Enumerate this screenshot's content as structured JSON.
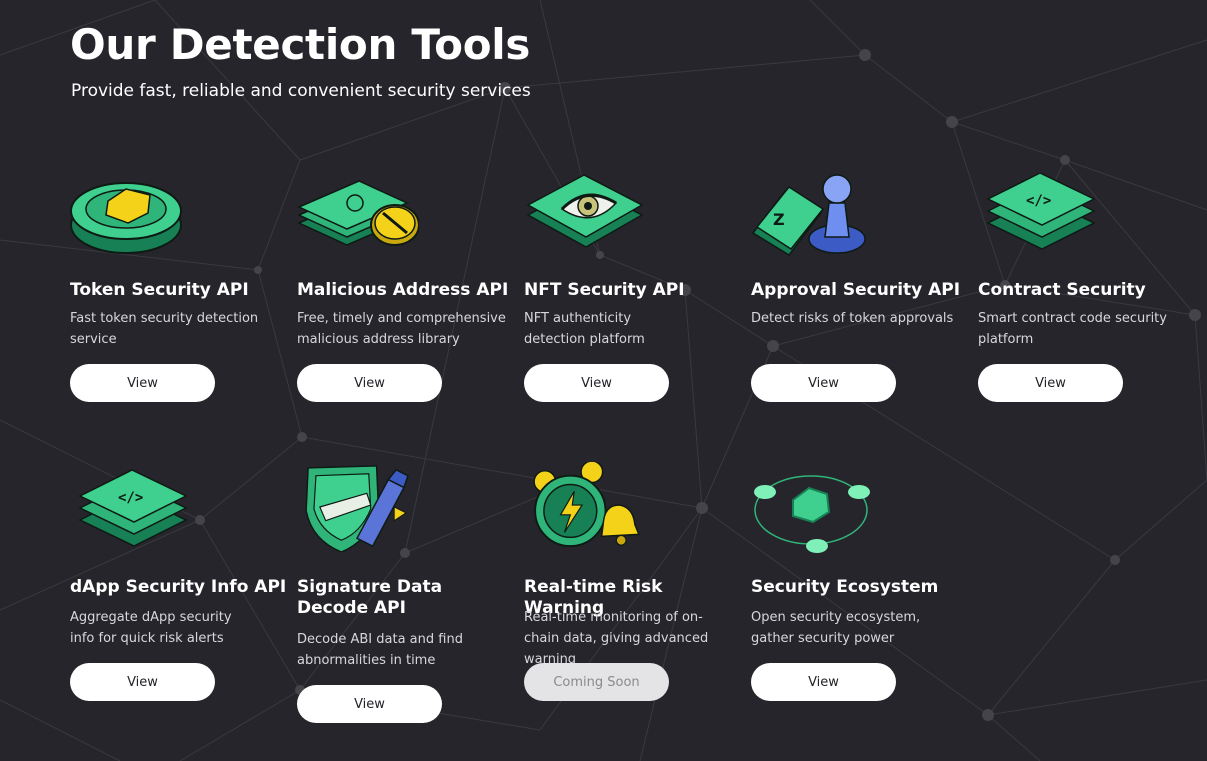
{
  "page": {
    "title": "Our Detection Tools",
    "subtitle": "Provide fast, reliable and convenient security services"
  },
  "cards": [
    {
      "title": "Token Security API",
      "description": "Fast token security detection service",
      "button": "View",
      "icon": "token-coin-icon"
    },
    {
      "title": "Malicious Address API",
      "description": "Free, timely and comprehensive malicious address library",
      "button": "View",
      "icon": "banknote-stack-icon"
    },
    {
      "title": "NFT Security API",
      "description": "NFT authenticity detection platform",
      "button": "View",
      "icon": "eye-tile-icon"
    },
    {
      "title": "Approval Security API",
      "description": "Detect risks of token approvals",
      "button": "View",
      "icon": "approval-stamp-icon"
    },
    {
      "title": "Contract Security",
      "description": "Smart contract code security platform",
      "button": "View",
      "icon": "code-layers-icon"
    },
    {
      "title": "dApp Security Info API",
      "description": "Aggregate dApp security info for quick risk alerts",
      "button": "View",
      "icon": "code-layers-icon"
    },
    {
      "title": "Signature Data Decode API",
      "description": "Decode ABI data and find abnormalities in time",
      "button": "View",
      "icon": "shield-pen-icon"
    },
    {
      "title": "Real-time Risk Warning",
      "description": "Real-time monitoring of on-chain data, giving advanced warning",
      "button": "Coming Soon",
      "icon": "alarm-clock-icon"
    },
    {
      "title": "Security Ecosystem",
      "description": "Open security ecosystem, gather security power",
      "button": "View",
      "icon": "ecosystem-orbit-icon"
    }
  ],
  "colors": {
    "background": "#26252b",
    "accent_green": "#3fcf8e",
    "dark_green": "#1f8f5f",
    "gold": "#f5d21a",
    "blue": "#6f8ff0"
  }
}
